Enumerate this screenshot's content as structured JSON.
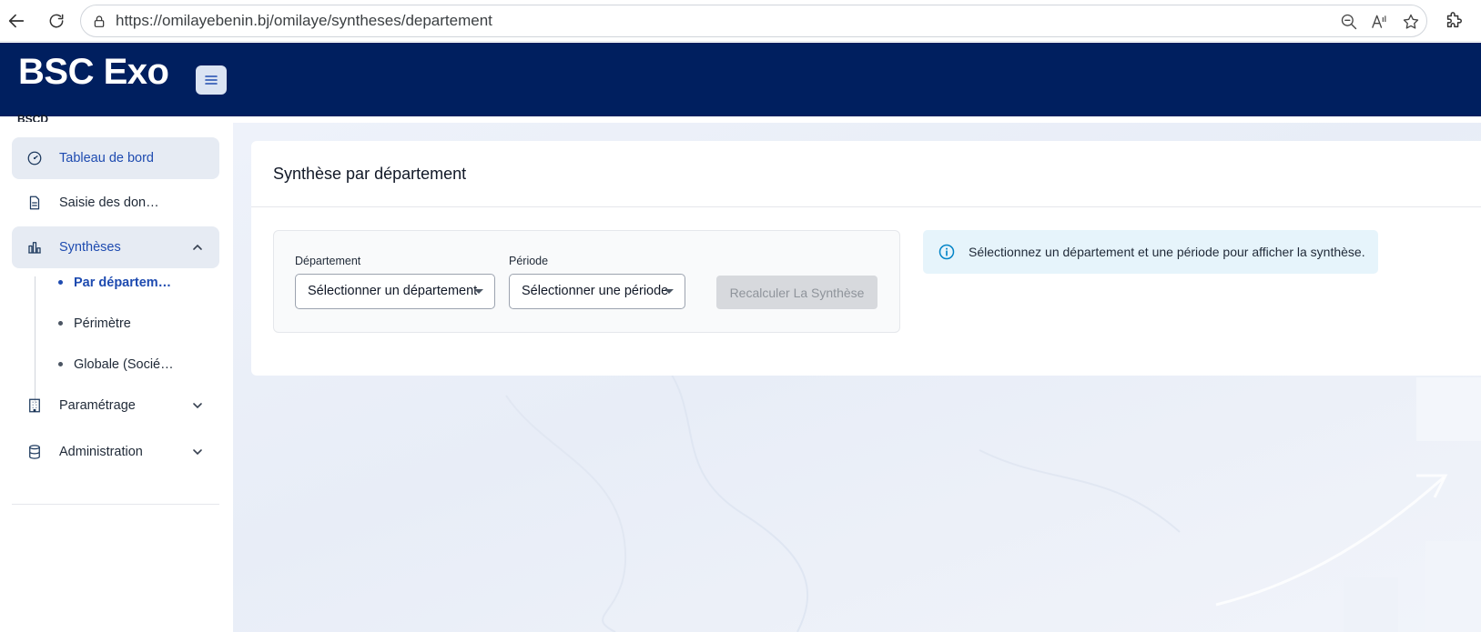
{
  "browser": {
    "url": "https://omilayebenin.bj/omilaye/syntheses/departement"
  },
  "header": {
    "brand": "BSC Exo",
    "brand_sub": "BSCD"
  },
  "sidebar": {
    "items": [
      {
        "label": "Tableau de bord",
        "icon": "gauge-icon"
      },
      {
        "label": "Saisie des don…",
        "icon": "document-icon"
      },
      {
        "label": "Synthèses",
        "icon": "bar-chart-icon"
      },
      {
        "label": "Paramétrage",
        "icon": "building-icon"
      },
      {
        "label": "Administration",
        "icon": "database-icon"
      }
    ],
    "synthese_sub": [
      {
        "label": "Par départem…"
      },
      {
        "label": "Périmètre"
      },
      {
        "label": "Globale (Socié…"
      }
    ]
  },
  "main": {
    "title": "Synthèse par département",
    "filters": {
      "departement_label": "Département",
      "departement_value": "Sélectionner un département",
      "periode_label": "Période",
      "periode_value": "Sélectionner une période",
      "recalc_label": "Recalculer La Synthèse"
    },
    "info": "Sélectionnez un département et une période pour afficher la synthèse."
  },
  "colors": {
    "header_bg": "#001f5f",
    "accent": "#1e4bb0",
    "active_bg": "#e6ebf3",
    "info_bg": "#e6f4fb"
  }
}
